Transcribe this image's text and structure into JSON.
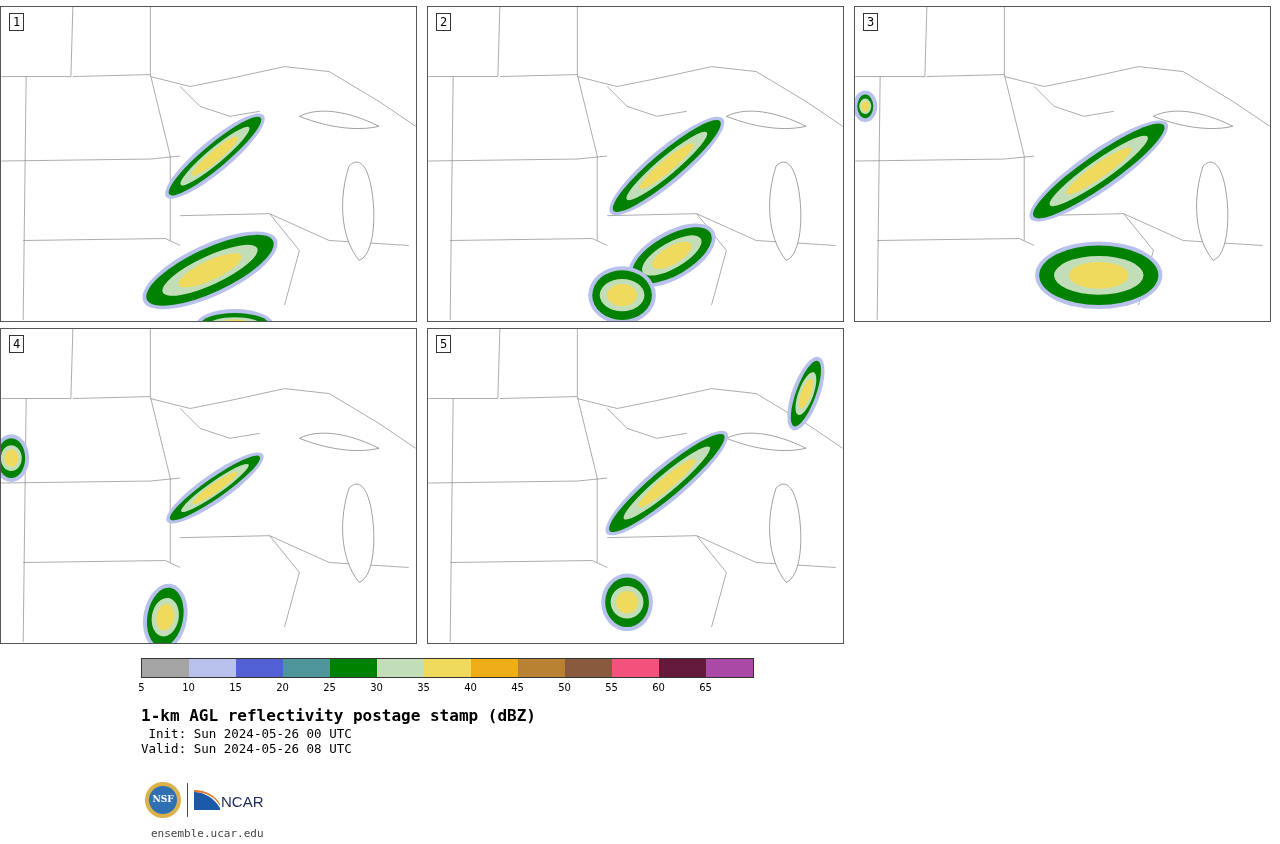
{
  "panels": [
    {
      "label": "1"
    },
    {
      "label": "2"
    },
    {
      "label": "3"
    },
    {
      "label": "4"
    },
    {
      "label": "5"
    }
  ],
  "colorbar": {
    "segments": [
      {
        "color": "#a5a5a5"
      },
      {
        "color": "#b8c1ec"
      },
      {
        "color": "#5260d6"
      },
      {
        "color": "#4f959c"
      },
      {
        "color": "#008200"
      },
      {
        "color": "#c1deb9"
      },
      {
        "color": "#efda5e"
      },
      {
        "color": "#efae18"
      },
      {
        "color": "#b98232"
      },
      {
        "color": "#8a5a3e"
      },
      {
        "color": "#f4527c"
      },
      {
        "color": "#641a3a"
      },
      {
        "color": "#ab4aa6"
      }
    ],
    "ticks": [
      "5",
      "10",
      "15",
      "20",
      "25",
      "30",
      "35",
      "40",
      "45",
      "50",
      "55",
      "60",
      "65"
    ]
  },
  "title": "1-km AGL reflectivity postage stamp (dBZ)",
  "init": " Init: Sun 2024-05-26 00 UTC",
  "valid": "Valid: Sun 2024-05-26 08 UTC",
  "logos": {
    "nsf": "NSF",
    "ncar": "NCAR"
  },
  "site": "ensemble.ucar.edu"
}
